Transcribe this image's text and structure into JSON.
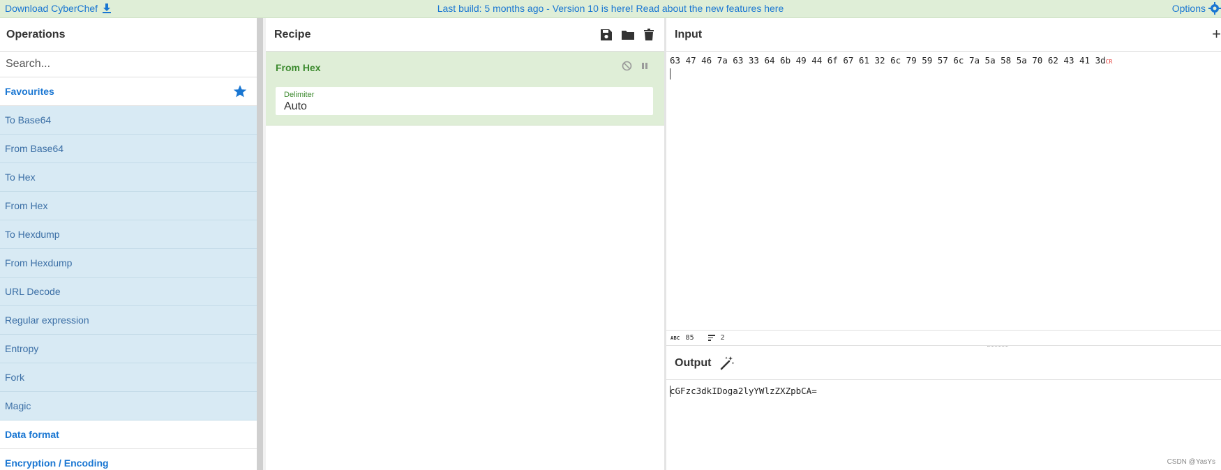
{
  "banner": {
    "download_label": "Download CyberChef",
    "download_icon": "download-icon",
    "message": "Last build: 5 months ago - Version 10 is here! Read about the new features here",
    "options_label": "Options",
    "options_icon": "gear-icon"
  },
  "operations": {
    "title": "Operations",
    "search_placeholder": "Search...",
    "favourites_label": "Favourites",
    "favourites_icon": "star-icon",
    "items": [
      {
        "label": "To Base64"
      },
      {
        "label": "From Base64"
      },
      {
        "label": "To Hex"
      },
      {
        "label": "From Hex"
      },
      {
        "label": "To Hexdump"
      },
      {
        "label": "From Hexdump"
      },
      {
        "label": "URL Decode"
      },
      {
        "label": "Regular expression"
      },
      {
        "label": "Entropy"
      },
      {
        "label": "Fork"
      },
      {
        "label": "Magic"
      }
    ],
    "categories": [
      {
        "label": "Data format"
      },
      {
        "label": "Encryption / Encoding"
      }
    ]
  },
  "recipe": {
    "title": "Recipe",
    "tools": [
      "save-icon",
      "folder-icon",
      "trash-icon"
    ],
    "operation": {
      "name": "From Hex",
      "field_label": "Delimiter",
      "field_value": "Auto"
    }
  },
  "input": {
    "title": "Input",
    "text": "63 47 46 7a 63 33 64 6b 49 44 6f 67 61 32 6c 79 59 57 6c 7a 5a 58 5a 70 62 43 41 3d",
    "line_end_marker": "CR",
    "char_count": "85",
    "line_count": "2"
  },
  "output": {
    "title": "Output",
    "text": "cGFzc3dkIDoga2lyYWlzZXZpbCA="
  },
  "watermark": "CSDN @YasYs",
  "colors": {
    "banner_bg": "#dfeed7",
    "link_blue": "#1976d2",
    "favourite_bg": "#d8eaf4",
    "recipe_green": "#3c8a2e"
  }
}
